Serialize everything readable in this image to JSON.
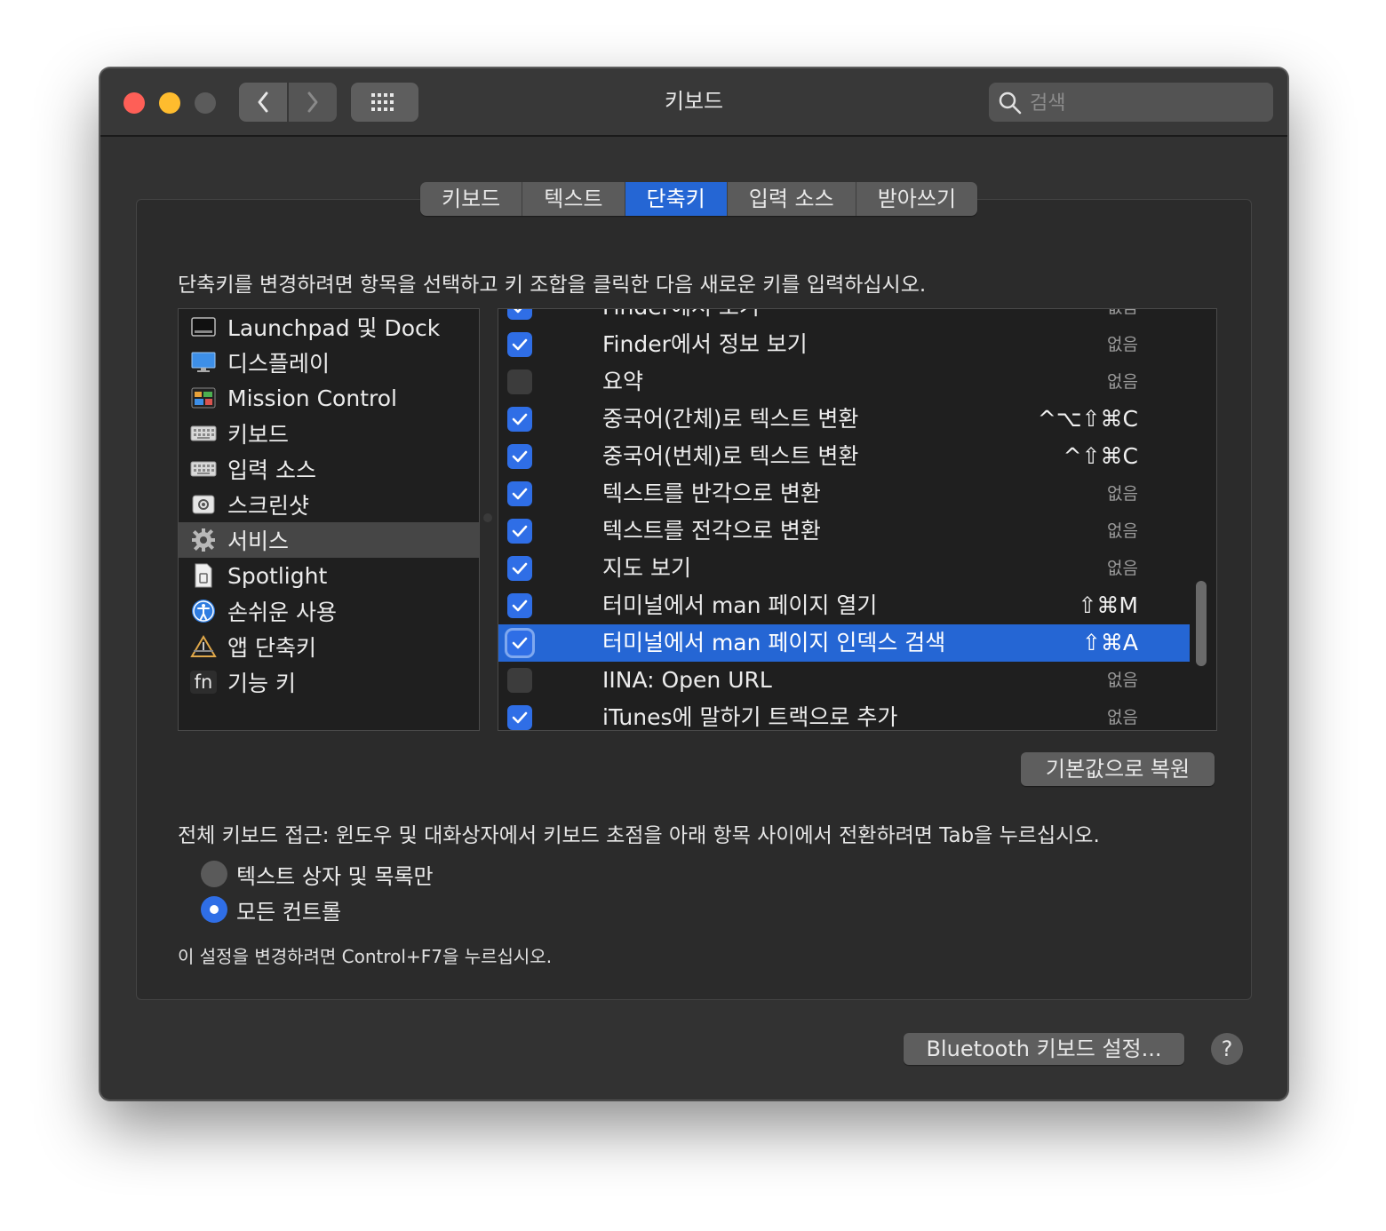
{
  "window": {
    "title": "키보드",
    "search_placeholder": "검색"
  },
  "tabs": [
    {
      "label": "키보드",
      "active": false
    },
    {
      "label": "텍스트",
      "active": false
    },
    {
      "label": "단축키",
      "active": true
    },
    {
      "label": "입력 소스",
      "active": false
    },
    {
      "label": "받아쓰기",
      "active": false
    }
  ],
  "instructions": "단축키를 변경하려면 항목을 선택하고 키 조합을 클릭한 다음 새로운 키를 입력하십시오.",
  "categories": [
    {
      "label": "Launchpad 및 Dock",
      "icon": "launchpad-icon",
      "selected": false
    },
    {
      "label": "디스플레이",
      "icon": "display-icon",
      "selected": false
    },
    {
      "label": "Mission Control",
      "icon": "mission-control-icon",
      "selected": false
    },
    {
      "label": "키보드",
      "icon": "keyboard-icon",
      "selected": false
    },
    {
      "label": "입력 소스",
      "icon": "input-source-icon",
      "selected": false
    },
    {
      "label": "스크린샷",
      "icon": "screenshot-icon",
      "selected": false
    },
    {
      "label": "서비스",
      "icon": "gear-icon",
      "selected": true
    },
    {
      "label": "Spotlight",
      "icon": "spotlight-icon",
      "selected": false
    },
    {
      "label": "손쉬운 사용",
      "icon": "accessibility-icon",
      "selected": false
    },
    {
      "label": "앱 단축키",
      "icon": "app-shortcuts-icon",
      "selected": false
    },
    {
      "label": "기능 키",
      "icon": "fn-key-icon",
      "selected": false,
      "icon_text": "fn"
    }
  ],
  "services": [
    {
      "label": "Finder에서 보기",
      "shortcut": "없음",
      "checked": true,
      "selected": false,
      "partial": true
    },
    {
      "label": "Finder에서 정보 보기",
      "shortcut": "없음",
      "checked": true,
      "selected": false
    },
    {
      "label": "요약",
      "shortcut": "없음",
      "checked": false,
      "selected": false
    },
    {
      "label": "중국어(간체)로 텍스트 변환",
      "shortcut": "^⌥⇧⌘C",
      "checked": true,
      "selected": false
    },
    {
      "label": "중국어(번체)로 텍스트 변환",
      "shortcut": "^⇧⌘C",
      "checked": true,
      "selected": false
    },
    {
      "label": "텍스트를 반각으로 변환",
      "shortcut": "없음",
      "checked": true,
      "selected": false
    },
    {
      "label": "텍스트를 전각으로 변환",
      "shortcut": "없음",
      "checked": true,
      "selected": false
    },
    {
      "label": "지도 보기",
      "shortcut": "없음",
      "checked": true,
      "selected": false
    },
    {
      "label": "터미널에서 man 페이지 열기",
      "shortcut": "⇧⌘M",
      "checked": true,
      "selected": false
    },
    {
      "label": "터미널에서 man 페이지 인덱스 검색",
      "shortcut": "⇧⌘A",
      "checked": true,
      "selected": true
    },
    {
      "label": "IINA: Open URL",
      "shortcut": "없음",
      "checked": false,
      "selected": false
    },
    {
      "label": "iTunes에 말하기 트랙으로 추가",
      "shortcut": "없음",
      "checked": true,
      "selected": false
    }
  ],
  "restore_button": "기본값으로 복원",
  "full_keyboard_access": "전체 키보드 접근: 윈도우 및 대화상자에서 키보드 초점을 아래 항목 사이에서 전환하려면 Tab을 누르십시오.",
  "radio_options": [
    {
      "label": "텍스트 상자 및 목록만",
      "selected": false
    },
    {
      "label": "모든 컨트롤",
      "selected": true
    }
  ],
  "note": "이 설정을 변경하려면 Control+F7을 누르십시오.",
  "bluetooth_button": "Bluetooth 키보드 설정...",
  "help_button": "?",
  "colors": {
    "accent": "#2566d4",
    "window_bg": "#323232",
    "list_bg": "#1f1f1f"
  }
}
